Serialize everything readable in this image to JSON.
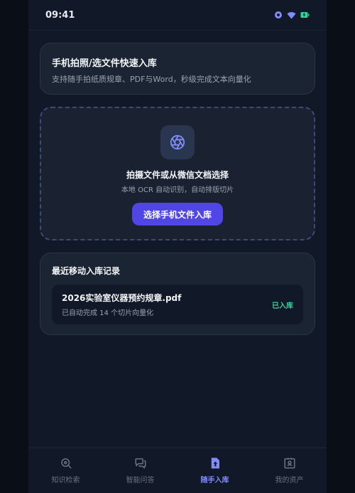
{
  "status_bar": {
    "time": "09:41"
  },
  "header": {
    "title": "手机拍照/选文件快速入库",
    "subtitle": "支持随手拍纸质规章、PDF与Word，秒级完成文本向量化"
  },
  "upload": {
    "title": "拍摄文件或从微信文档选择",
    "subtitle": "本地 OCR 自动识别，自动排版切片",
    "button_label": "选择手机文件入库"
  },
  "records": {
    "title": "最近移动入库记录",
    "items": [
      {
        "name": "2026实验室仪器预约规章.pdf",
        "detail": "已自动完成 14 个切片向量化",
        "status": "已入库"
      }
    ]
  },
  "nav": {
    "items": [
      {
        "label": "知识检索",
        "icon": "search-icon"
      },
      {
        "label": "智能问答",
        "icon": "chat-icon"
      },
      {
        "label": "随手入库",
        "icon": "upload-file-icon",
        "active": true
      },
      {
        "label": "我的资产",
        "icon": "profile-card-icon"
      }
    ]
  },
  "colors": {
    "accent": "#4f46e5",
    "success": "#34d399",
    "background": "#111827"
  }
}
